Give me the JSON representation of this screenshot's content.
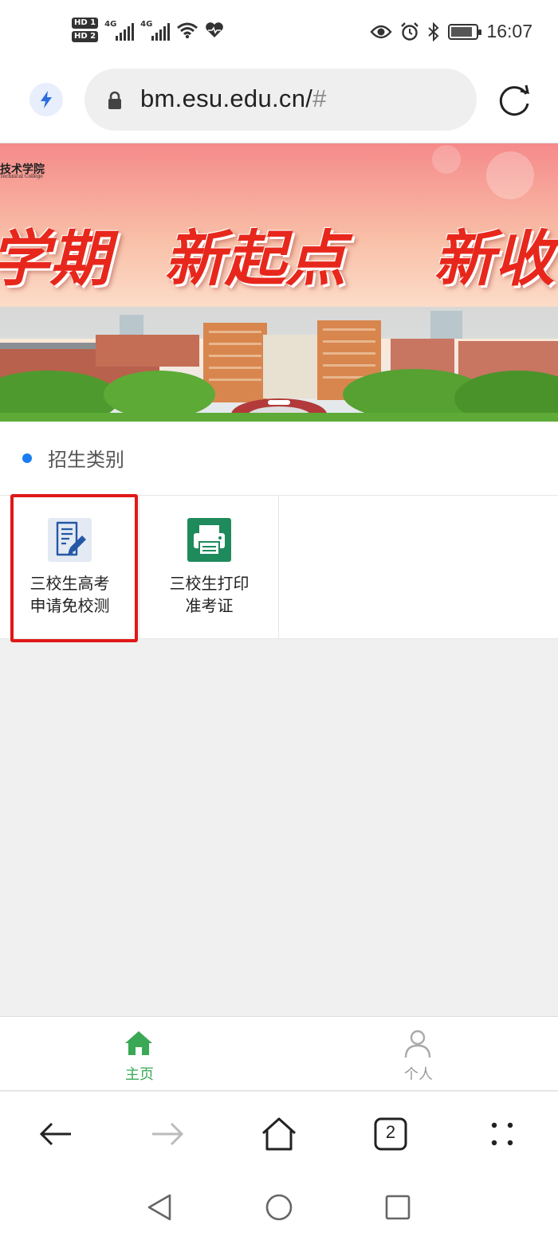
{
  "status_bar": {
    "sim1_label": "HD 1",
    "sim2_label": "HD 2",
    "net1": "4G",
    "net2": "4G",
    "time": "16:07",
    "battery_level": 0.85
  },
  "browser": {
    "url_host": "bm.esu.edu.cn/",
    "url_rest": "#",
    "tabs_count": "2"
  },
  "banner": {
    "logo_text": "技术学院",
    "logo_sub": "Technical College",
    "slogan_1": "学期",
    "slogan_2": "新起点",
    "slogan_3": "新收"
  },
  "section": {
    "title": "招生类别"
  },
  "services": [
    {
      "label_line1": "三校生高考",
      "label_line2": "申请免校测",
      "icon": "document-edit-icon"
    },
    {
      "label_line1": "三校生打印",
      "label_line2": "准考证",
      "icon": "printer-icon"
    }
  ],
  "tabbar": {
    "home_label": "主页",
    "me_label": "个人"
  },
  "colors": {
    "accent_green": "#3aa854",
    "section_dot": "#1a7cf0",
    "highlight_red": "#e01818"
  }
}
